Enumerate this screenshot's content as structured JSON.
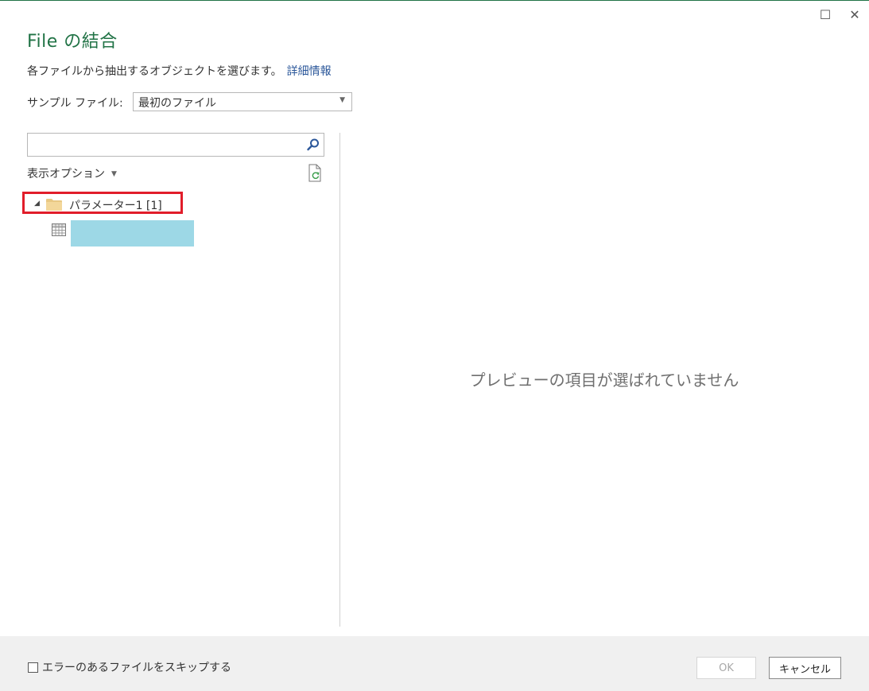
{
  "window": {
    "maximize_glyph": "☐",
    "close_glyph": "✕"
  },
  "dialog": {
    "title": "File の結合",
    "description": "各ファイルから抽出するオブジェクトを選びます。",
    "details_link": "詳細情報"
  },
  "sample_file": {
    "label": "サンプル ファイル:",
    "selected": "最初のファイル"
  },
  "navigator": {
    "search_value": "",
    "view_options_label": "表示オプション",
    "tree": {
      "node_label": "パラメーター1 [1]",
      "expanded": true,
      "child_label": ""
    }
  },
  "preview": {
    "empty_message": "プレビューの項目が選ばれていません"
  },
  "footer": {
    "skip_errors_label": "エラーのあるファイルをスキップする",
    "skip_errors_checked": false,
    "ok_label": "OK",
    "cancel_label": "キャンセル"
  },
  "colors": {
    "title_green": "#217346",
    "link_blue": "#2b579a",
    "highlight_red": "#e11d2a",
    "selection_blue": "#9dd8e6",
    "footer_bg": "#f0f0f0"
  }
}
